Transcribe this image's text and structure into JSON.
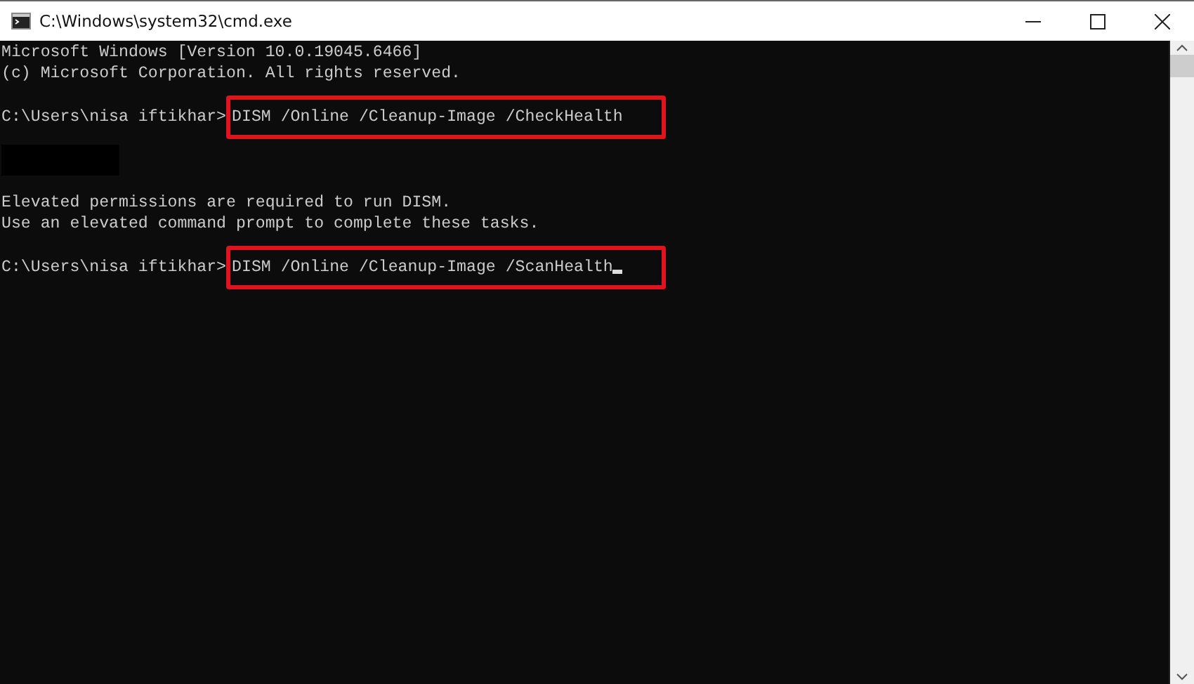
{
  "window": {
    "title": "C:\\Windows\\system32\\cmd.exe"
  },
  "console": [
    {
      "kind": "text",
      "text": "Microsoft Windows [Version 10.0.19045.6466]"
    },
    {
      "kind": "text",
      "text": "(c) Microsoft Corporation. All rights reserved."
    },
    {
      "kind": "blank"
    },
    {
      "kind": "prompt",
      "prompt": "C:\\Users\\nisa iftikhar>",
      "command": "DISM /Online /Cleanup-Image /CheckHealth",
      "highlighted": true,
      "cursor": false
    },
    {
      "kind": "blank"
    },
    {
      "kind": "redacted"
    },
    {
      "kind": "blank"
    },
    {
      "kind": "text",
      "text": "Elevated permissions are required to run DISM."
    },
    {
      "kind": "text",
      "text": "Use an elevated command prompt to complete these tasks."
    },
    {
      "kind": "blank"
    },
    {
      "kind": "prompt",
      "prompt": "C:\\Users\\nisa iftikhar>",
      "command": "DISM /Online /Cleanup-Image /ScanHealth",
      "highlighted": true,
      "cursor": true
    }
  ]
}
